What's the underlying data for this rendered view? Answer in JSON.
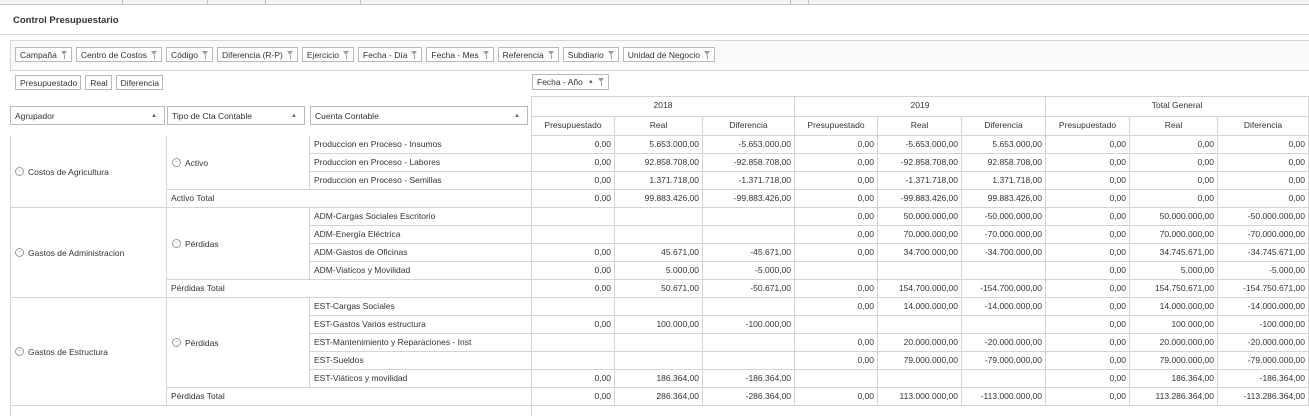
{
  "page_title": "Control Presupuestario",
  "filters": [
    {
      "label": "Campaña",
      "name": "filter-campana"
    },
    {
      "label": "Centro de Costos",
      "name": "filter-centro-costos"
    },
    {
      "label": "Código",
      "name": "filter-codigo"
    },
    {
      "label": "Diferencia (R-P)",
      "name": "filter-diferencia-rp"
    },
    {
      "label": "Ejercicio",
      "name": "filter-ejercicio"
    },
    {
      "label": "Fecha - Día",
      "name": "filter-fecha-dia"
    },
    {
      "label": "Fecha - Mes",
      "name": "filter-fecha-mes"
    },
    {
      "label": "Referencia",
      "name": "filter-referencia"
    },
    {
      "label": "Subdiario",
      "name": "filter-subdiario"
    },
    {
      "label": "Unidad de Negocio",
      "name": "filter-unidad-negocio"
    }
  ],
  "data_fields": [
    "Presupuestado",
    "Real",
    "Diferencia"
  ],
  "column_field": "Fecha - Año",
  "row_fields": [
    "Agrupador",
    "Tipo de Cta Contable",
    "Cuenta Contable"
  ],
  "years": [
    "2018",
    "2019",
    "Total General"
  ],
  "measures": [
    "Presupuestado",
    "Real",
    "Diferencia"
  ],
  "groups": [
    {
      "name": "Costos de Agricultura",
      "type": "Activo",
      "rows": [
        {
          "account": "Produccion en Proceso - Insumos",
          "values": [
            "0,00",
            "5.653.000,00",
            "-5.653.000,00",
            "0,00",
            "-5.653.000,00",
            "5.653.000,00",
            "0,00",
            "0,00",
            "0,00"
          ]
        },
        {
          "account": "Produccion en Proceso - Labores",
          "values": [
            "0,00",
            "92.858.708,00",
            "-92.858.708,00",
            "0,00",
            "-92.858.708,00",
            "92.858.708,00",
            "0,00",
            "0,00",
            "0,00"
          ]
        },
        {
          "account": "Produccion en Proceso - Semillas",
          "values": [
            "0,00",
            "1.371.718,00",
            "-1.371.718,00",
            "0,00",
            "-1.371.718,00",
            "1.371.718,00",
            "0,00",
            "0,00",
            "0,00"
          ]
        }
      ],
      "total_label": "Activo Total",
      "total": [
        "0,00",
        "99.883.426,00",
        "-99.883.426,00",
        "0,00",
        "-99.883.426,00",
        "99.883.426,00",
        "0,00",
        "0,00",
        "0,00"
      ]
    },
    {
      "name": "Gastos de Administracion",
      "type": "Pérdidas",
      "rows": [
        {
          "account": "ADM-Cargas Sociales Escritorio",
          "values": [
            "",
            "",
            "",
            "0,00",
            "50.000.000,00",
            "-50.000.000,00",
            "0,00",
            "50.000.000,00",
            "-50.000.000,00"
          ]
        },
        {
          "account": "ADM-Energía Eléctrica",
          "values": [
            "",
            "",
            "",
            "0,00",
            "70.000.000,00",
            "-70.000.000,00",
            "0,00",
            "70.000.000,00",
            "-70.000.000,00"
          ]
        },
        {
          "account": "ADM-Gastos de Oficinas",
          "values": [
            "0,00",
            "45.671,00",
            "-45.671,00",
            "0,00",
            "34.700.000,00",
            "-34.700.000,00",
            "0,00",
            "34.745.671,00",
            "-34.745.671,00"
          ]
        },
        {
          "account": "ADM-Viaticos y Movilidad",
          "values": [
            "0,00",
            "5.000,00",
            "-5.000,00",
            "",
            "",
            "",
            "0,00",
            "5.000,00",
            "-5.000,00"
          ]
        }
      ],
      "total_label": "Pérdidas Total",
      "total": [
        "0,00",
        "50.671,00",
        "-50.671,00",
        "0,00",
        "154.700.000,00",
        "-154.700.000,00",
        "0,00",
        "154.750.671,00",
        "-154.750.671,00"
      ]
    },
    {
      "name": "Gastos de Estructura",
      "type": "Pérdidas",
      "rows": [
        {
          "account": "EST-Cargas Sociales",
          "values": [
            "",
            "",
            "",
            "0,00",
            "14.000.000,00",
            "-14.000.000,00",
            "0,00",
            "14.000.000,00",
            "-14.000.000,00"
          ]
        },
        {
          "account": "EST-Gastos Varios estructura",
          "values": [
            "0,00",
            "100.000,00",
            "-100.000,00",
            "",
            "",
            "",
            "0,00",
            "100.000,00",
            "-100.000,00"
          ]
        },
        {
          "account": "EST-Mantenimiento y Reparaciones - Inst",
          "values": [
            "",
            "",
            "",
            "0,00",
            "20.000.000,00",
            "-20.000.000,00",
            "0,00",
            "20.000.000,00",
            "-20.000.000,00"
          ]
        },
        {
          "account": "EST-Sueldos",
          "values": [
            "",
            "",
            "",
            "0,00",
            "79.000.000,00",
            "-79.000.000,00",
            "0,00",
            "79.000.000,00",
            "-79.000.000,00"
          ]
        },
        {
          "account": "EST-Viáticos y movilidad",
          "values": [
            "0,00",
            "186.364,00",
            "-186.364,00",
            "",
            "",
            "",
            "0,00",
            "186.364,00",
            "-186.364,00"
          ]
        }
      ],
      "total_label": "Pérdidas Total",
      "total": [
        "0,00",
        "286.364,00",
        "-286.364,00",
        "0,00",
        "113.000.000,00",
        "-113.000.000,00",
        "0,00",
        "113.286.364,00",
        "-113.286.364,00"
      ]
    }
  ]
}
